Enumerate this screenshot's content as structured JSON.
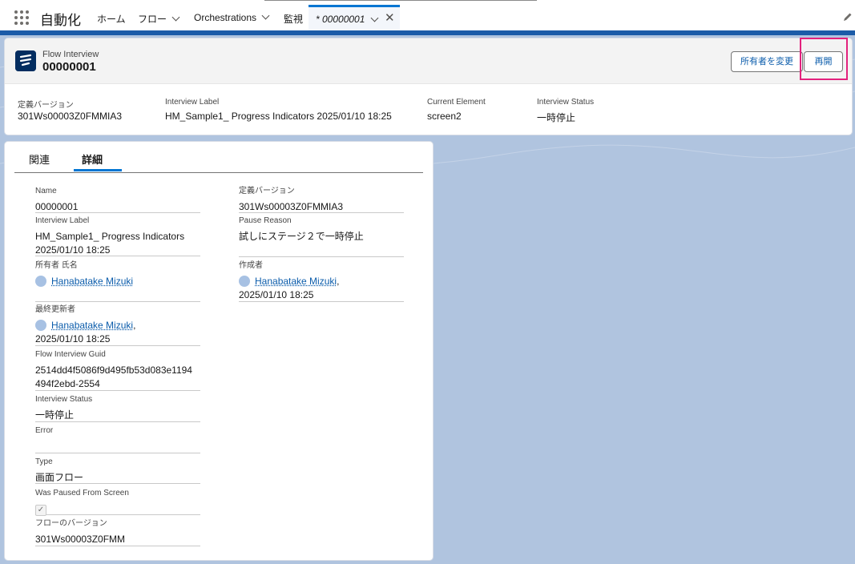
{
  "nav": {
    "app_name": "自動化",
    "items": [
      {
        "label": "ホーム"
      },
      {
        "label": "フロー"
      },
      {
        "label": "Orchestrations"
      },
      {
        "label": "監視"
      }
    ],
    "active_tab": {
      "label": "* 00000001"
    }
  },
  "header": {
    "object_type": "Flow Interview",
    "record_name": "00000001",
    "buttons": {
      "change_owner": "所有者を変更",
      "resume": "再開"
    },
    "fields": [
      {
        "label": "定義バージョン",
        "value": "301Ws00003Z0FMMIA3"
      },
      {
        "label": "Interview Label",
        "value": "HM_Sample1_ Progress Indicators 2025/01/10 18:25"
      },
      {
        "label": "Current Element",
        "value": "screen2"
      },
      {
        "label": "Interview Status",
        "value": "一時停止"
      }
    ]
  },
  "tabs": {
    "related": "関連",
    "details": "詳細"
  },
  "details": {
    "name": {
      "label": "Name",
      "value": "00000001"
    },
    "definition_version": {
      "label": "定義バージョン",
      "value": "301Ws00003Z0FMMIA3"
    },
    "interview_label": {
      "label": "Interview Label",
      "value_line1": "HM_Sample1_ Progress Indicators",
      "value_line2": "2025/01/10 18:25"
    },
    "pause_reason": {
      "label": "Pause Reason",
      "value": "試しにステージ２で一時停止"
    },
    "owner": {
      "label": "所有者 氏名",
      "user": "Hanabatake Mizuki"
    },
    "created_by": {
      "label": "作成者",
      "user": "Hanabatake Mizuki",
      "date": "2025/01/10 18:25"
    },
    "last_modified_by": {
      "label": "最終更新者",
      "user": "Hanabatake Mizuki",
      "date": "2025/01/10 18:25"
    },
    "guid": {
      "label": "Flow Interview Guid",
      "value_line1": "2514dd4f5086f9d495fb53d083e1194",
      "value_line2": "494f2ebd-2554"
    },
    "interview_status": {
      "label": "Interview Status",
      "value": "一時停止"
    },
    "error": {
      "label": "Error",
      "value": ""
    },
    "type": {
      "label": "Type",
      "value": "画面フロー"
    },
    "was_paused_from_screen": {
      "label": "Was Paused From Screen",
      "checked": true
    },
    "flow_version": {
      "label": "フローのバージョン",
      "value": "301Ws00003Z0FMM"
    }
  },
  "colors": {
    "brand": "#0176d3",
    "highlight": "#e3217d",
    "link": "#0b5cab"
  }
}
